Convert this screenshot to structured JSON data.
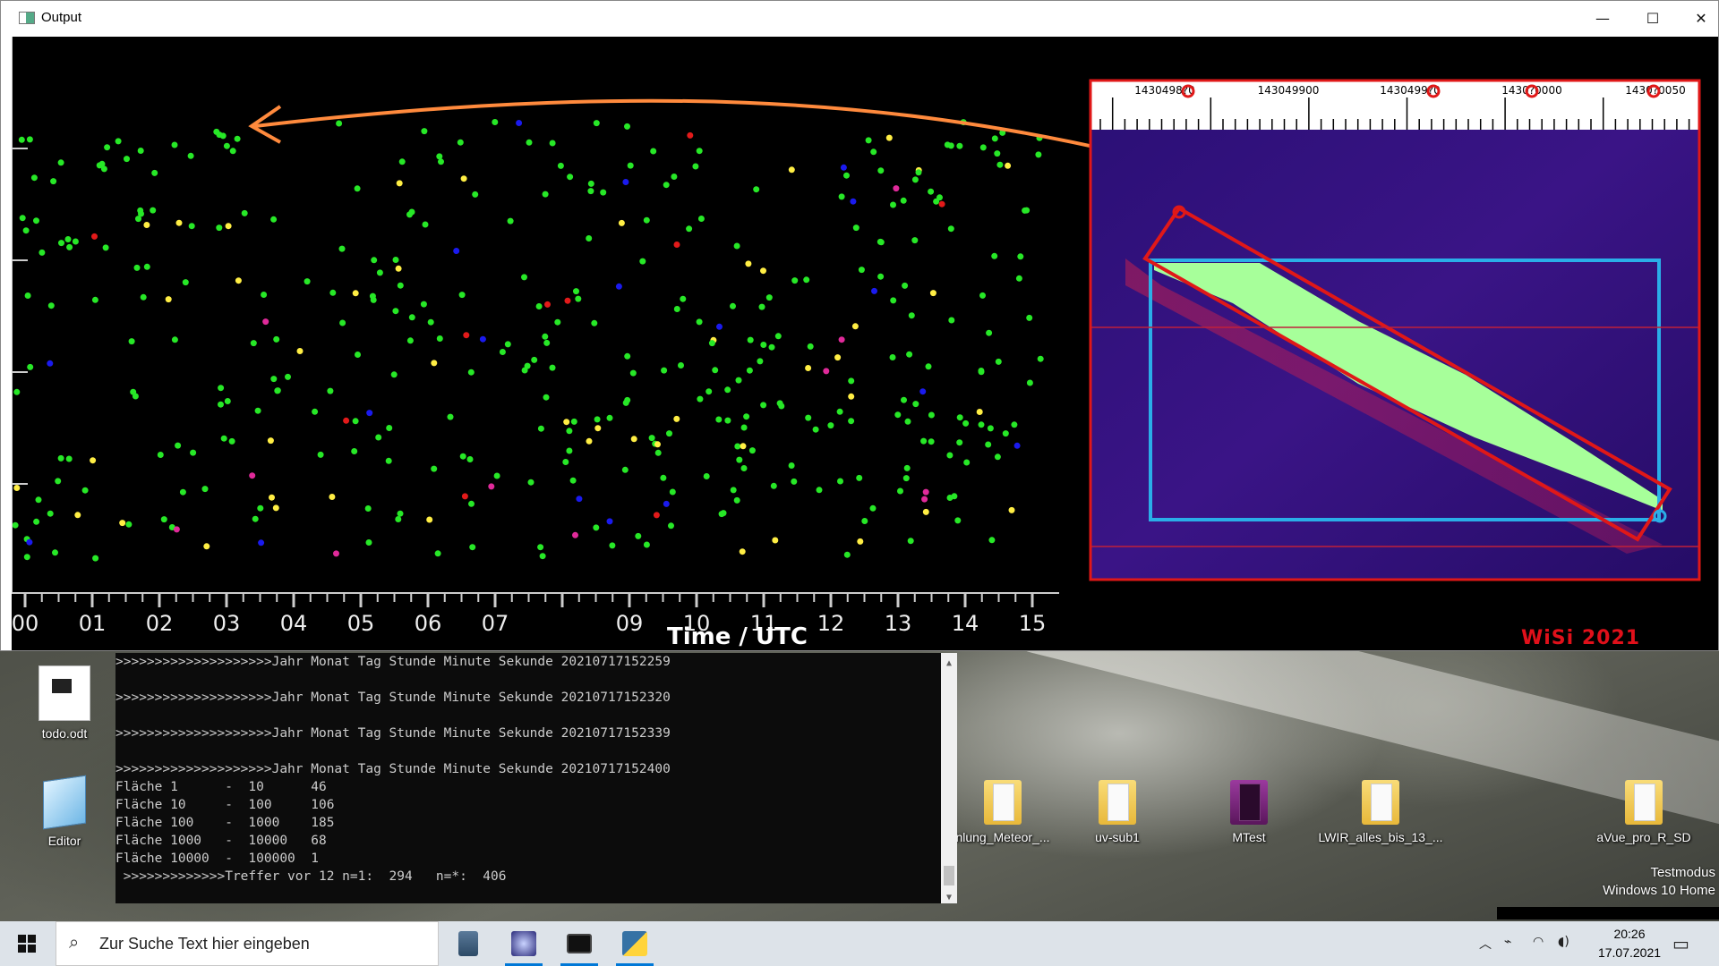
{
  "window": {
    "title": "Output",
    "controls": {
      "minimize": "—",
      "maximize": "☐",
      "close": "✕"
    }
  },
  "plot": {
    "x_axis_title": "Time / UTC",
    "x_tick_labels": [
      "00",
      "01",
      "02",
      "03",
      "04",
      "05",
      "06",
      "07",
      "09",
      "10",
      "11",
      "12",
      "13",
      "14",
      "15"
    ],
    "watermark": "WiSi 2021",
    "inset_scale_labels": [
      "1430498?0",
      "143049900",
      "1430499?0",
      "1430?0000",
      "1430?0050"
    ],
    "colors": {
      "green": "#27e827",
      "yellow": "#ffee44",
      "blue": "#1a1aee",
      "red": "#e21a1a",
      "magenta": "#e02a9a",
      "arrow": "#ff8a3d"
    }
  },
  "console": {
    "lines": [
      ">>>>>>>>>>>>>>>>>>>>Jahr Monat Tag Stunde Minute Sekunde 20210717152259",
      "",
      ">>>>>>>>>>>>>>>>>>>>Jahr Monat Tag Stunde Minute Sekunde 20210717152320",
      "",
      ">>>>>>>>>>>>>>>>>>>>Jahr Monat Tag Stunde Minute Sekunde 20210717152339",
      "",
      ">>>>>>>>>>>>>>>>>>>>Jahr Monat Tag Stunde Minute Sekunde 20210717152400",
      "Fläche 1      -  10      46",
      "Fläche 10     -  100     106",
      "Fläche 100    -  1000    185",
      "Fläche 1000   -  10000   68",
      "Fläche 10000  -  100000  1",
      " >>>>>>>>>>>>>Treffer vor 12 n=1:  294   n=*:  406"
    ]
  },
  "desktop_icons": [
    {
      "label": "todo.odt",
      "icon": "document-icon"
    },
    {
      "label": "Editor",
      "icon": "notepad-icon"
    },
    {
      "label": "nlung_Meteor_...",
      "icon": "folder-icon"
    },
    {
      "label": "uv-sub1",
      "icon": "folder-icon"
    },
    {
      "label": "MTest",
      "icon": "folder-icon"
    },
    {
      "label": "LWIR_alles_bis_13_...",
      "icon": "folder-icon"
    },
    {
      "label": "aVue_pro_R_SD",
      "icon": "folder-icon"
    }
  ],
  "watermark_desktop": {
    "line1": "Testmodus",
    "line2": "Windows 10 Home"
  },
  "taskbar": {
    "search_placeholder": "Zur Suche Text hier eingeben",
    "apps": [
      "calculator-icon",
      "satellite-app-icon",
      "terminal-icon",
      "python-icon"
    ],
    "time": "20:26",
    "date": "17.07.2021"
  }
}
